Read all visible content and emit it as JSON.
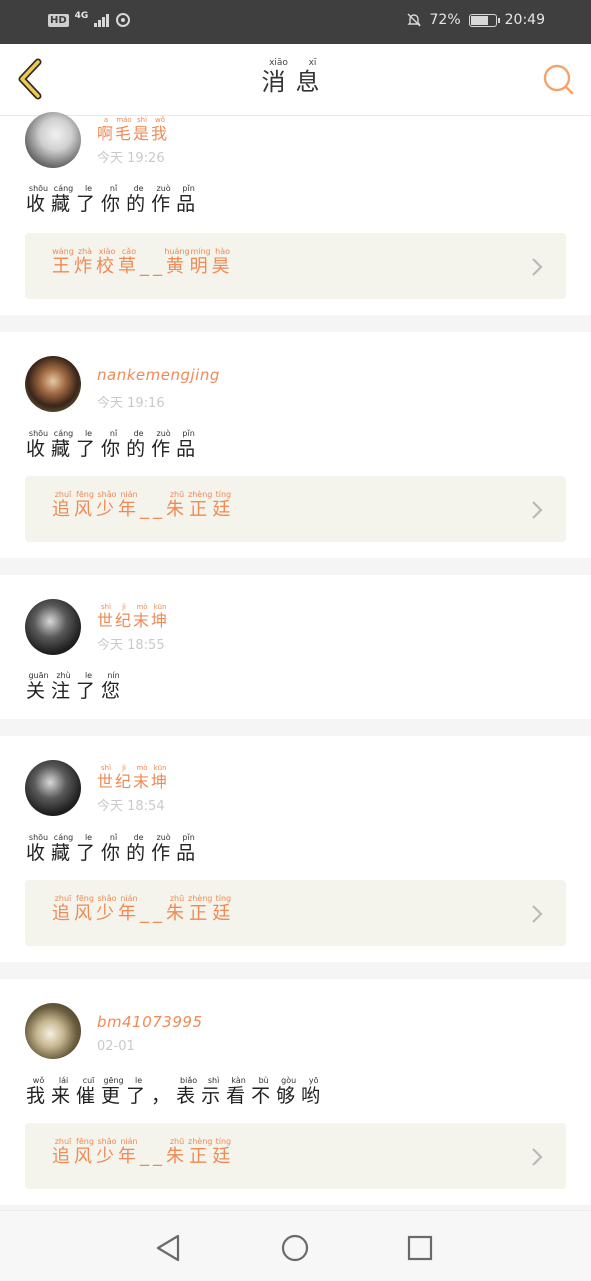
{
  "status": {
    "hd": "HD",
    "network": "4G",
    "battery_pct": "72%",
    "battery_level": 0.72,
    "time": "20:49"
  },
  "header": {
    "title": [
      {
        "c": "消",
        "p": "xiāo"
      },
      {
        "c": "息",
        "p": "xī"
      }
    ]
  },
  "messages": [
    {
      "name_ruby": [
        {
          "c": "啊",
          "p": "a"
        },
        {
          "c": "毛",
          "p": "máo"
        },
        {
          "c": "是",
          "p": "shì"
        },
        {
          "c": "我",
          "p": "wǒ"
        }
      ],
      "time": "今天 19:26",
      "text": [
        {
          "c": "收",
          "p": "shōu"
        },
        {
          "c": "藏",
          "p": "cáng"
        },
        {
          "c": "了",
          "p": "le"
        },
        {
          "c": "你",
          "p": "nǐ"
        },
        {
          "c": "的",
          "p": "de"
        },
        {
          "c": "作",
          "p": "zuò"
        },
        {
          "c": "品",
          "p": "pǐn"
        }
      ],
      "work": [
        {
          "c": "王",
          "p": "wáng"
        },
        {
          "c": "炸",
          "p": "zhà"
        },
        {
          "c": "校",
          "p": "xiào"
        },
        {
          "c": "草",
          "p": "cǎo"
        },
        {
          "c": "__",
          "p": ""
        },
        {
          "c": "黄",
          "p": "huáng"
        },
        {
          "c": "明",
          "p": "míng"
        },
        {
          "c": "昊",
          "p": "hào"
        }
      ]
    },
    {
      "name": "nankemengjing",
      "time": "今天 19:16",
      "text": [
        {
          "c": "收",
          "p": "shōu"
        },
        {
          "c": "藏",
          "p": "cáng"
        },
        {
          "c": "了",
          "p": "le"
        },
        {
          "c": "你",
          "p": "nǐ"
        },
        {
          "c": "的",
          "p": "de"
        },
        {
          "c": "作",
          "p": "zuò"
        },
        {
          "c": "品",
          "p": "pǐn"
        }
      ],
      "work": [
        {
          "c": "追",
          "p": "zhuī"
        },
        {
          "c": "风",
          "p": "fēng"
        },
        {
          "c": "少",
          "p": "shǎo"
        },
        {
          "c": "年",
          "p": "nián"
        },
        {
          "c": "__",
          "p": ""
        },
        {
          "c": "朱",
          "p": "zhū"
        },
        {
          "c": "正",
          "p": "zhèng"
        },
        {
          "c": "廷",
          "p": "tíng"
        }
      ]
    },
    {
      "name_ruby": [
        {
          "c": "世",
          "p": "shì"
        },
        {
          "c": "纪",
          "p": "jì"
        },
        {
          "c": "末",
          "p": "mò"
        },
        {
          "c": "坤",
          "p": "kūn"
        }
      ],
      "time": "今天 18:55",
      "text": [
        {
          "c": "关",
          "p": "guān"
        },
        {
          "c": "注",
          "p": "zhù"
        },
        {
          "c": "了",
          "p": "le"
        },
        {
          "c": "您",
          "p": "nín"
        }
      ]
    },
    {
      "name_ruby": [
        {
          "c": "世",
          "p": "shì"
        },
        {
          "c": "纪",
          "p": "jì"
        },
        {
          "c": "末",
          "p": "mò"
        },
        {
          "c": "坤",
          "p": "kūn"
        }
      ],
      "time": "今天 18:54",
      "text": [
        {
          "c": "收",
          "p": "shōu"
        },
        {
          "c": "藏",
          "p": "cáng"
        },
        {
          "c": "了",
          "p": "le"
        },
        {
          "c": "你",
          "p": "nǐ"
        },
        {
          "c": "的",
          "p": "de"
        },
        {
          "c": "作",
          "p": "zuò"
        },
        {
          "c": "品",
          "p": "pǐn"
        }
      ],
      "work": [
        {
          "c": "追",
          "p": "zhuī"
        },
        {
          "c": "风",
          "p": "fēng"
        },
        {
          "c": "少",
          "p": "shǎo"
        },
        {
          "c": "年",
          "p": "nián"
        },
        {
          "c": "__",
          "p": ""
        },
        {
          "c": "朱",
          "p": "zhū"
        },
        {
          "c": "正",
          "p": "zhèng"
        },
        {
          "c": "廷",
          "p": "tíng"
        }
      ]
    },
    {
      "name": "bm41073995",
      "time": "02-01",
      "text": [
        {
          "c": "我",
          "p": "wǒ"
        },
        {
          "c": "来",
          "p": "lái"
        },
        {
          "c": "催",
          "p": "cuī"
        },
        {
          "c": "更",
          "p": "gēng"
        },
        {
          "c": "了",
          "p": "le"
        },
        {
          "c": "，",
          "p": ""
        },
        {
          "c": "表",
          "p": "biǎo"
        },
        {
          "c": "示",
          "p": "shì"
        },
        {
          "c": "看",
          "p": "kàn"
        },
        {
          "c": "不",
          "p": "bù"
        },
        {
          "c": "够",
          "p": "gòu"
        },
        {
          "c": "哟",
          "p": "yō"
        }
      ],
      "work": [
        {
          "c": "追",
          "p": "zhuī"
        },
        {
          "c": "风",
          "p": "fēng"
        },
        {
          "c": "少",
          "p": "shǎo"
        },
        {
          "c": "年",
          "p": "nián"
        },
        {
          "c": "__",
          "p": ""
        },
        {
          "c": "朱",
          "p": "zhū"
        },
        {
          "c": "正",
          "p": "zhèng"
        },
        {
          "c": "廷",
          "p": "tíng"
        }
      ]
    }
  ],
  "colors": {
    "accent": "#f08a55",
    "back_icon": "#f2c94c",
    "work_bg": "#f4f3ec",
    "statusbar_bg": "#3f3f3f"
  },
  "icons": {
    "back": "chevron-left-icon",
    "search": "search-icon",
    "nav_back": "triangle-back-icon",
    "nav_home": "circle-home-icon",
    "nav_recent": "square-recents-icon"
  }
}
